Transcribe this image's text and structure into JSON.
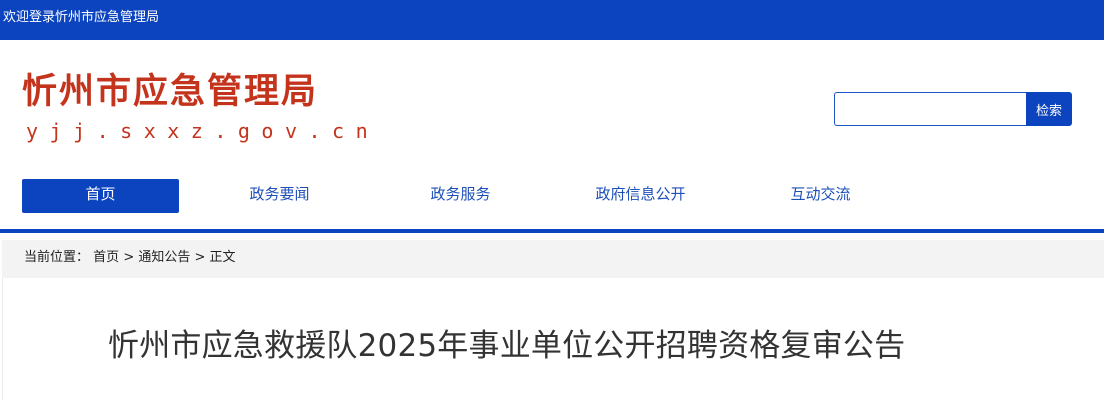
{
  "topbar": {
    "welcome": "欢迎登录忻州市应急管理局"
  },
  "brand": {
    "name": "忻州市应急管理局",
    "domain": "yjj.sxxz.gov.cn"
  },
  "search": {
    "value": "",
    "button_label": "检索"
  },
  "nav": {
    "items": [
      {
        "label": "首页",
        "active": true
      },
      {
        "label": "政务要闻",
        "active": false
      },
      {
        "label": "政务服务",
        "active": false
      },
      {
        "label": "政府信息公开",
        "active": false
      },
      {
        "label": "互动交流",
        "active": false
      }
    ]
  },
  "breadcrumb": {
    "prefix": "当前位置：",
    "items": [
      "首页",
      "通知公告",
      "正文"
    ],
    "separator": " > "
  },
  "article": {
    "title": "忻州市应急救援队2025年事业单位公开招聘资格复审公告"
  },
  "colors": {
    "primary": "#0c44c0",
    "brand_red": "#c4341d"
  }
}
